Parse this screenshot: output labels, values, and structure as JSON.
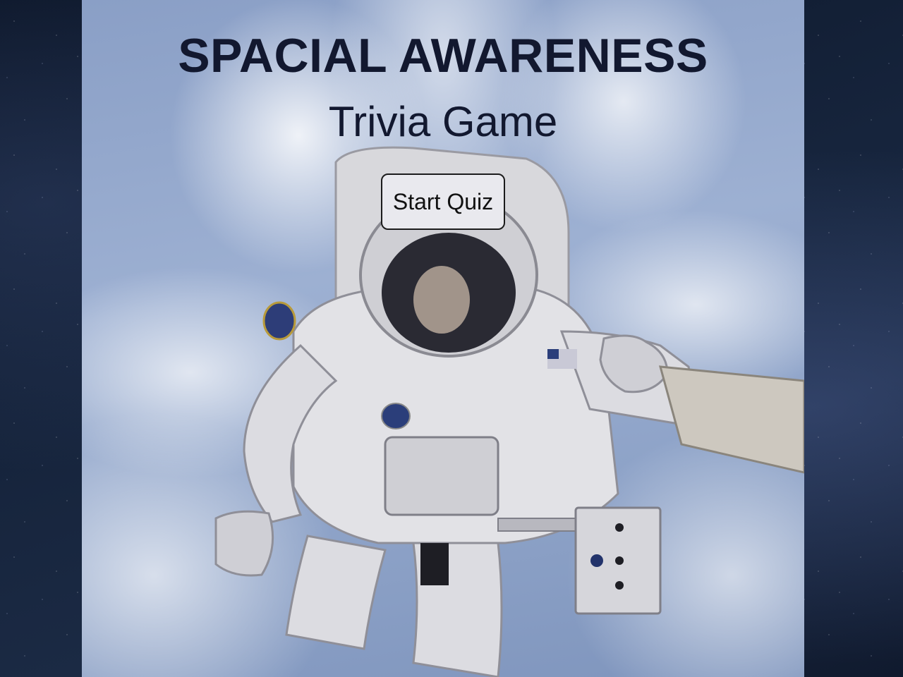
{
  "header": {
    "title": "SPACIAL AWARENESS",
    "subtitle": "Trivia Game"
  },
  "actions": {
    "start_label": "Start Quiz"
  },
  "background": {
    "image": "astronaut-spacewalk-image",
    "outer": "starfield"
  },
  "colors": {
    "title": "#12182f",
    "button_bg": "#e9e9ee",
    "button_border": "#1c1c1c",
    "space": "#16243c"
  }
}
